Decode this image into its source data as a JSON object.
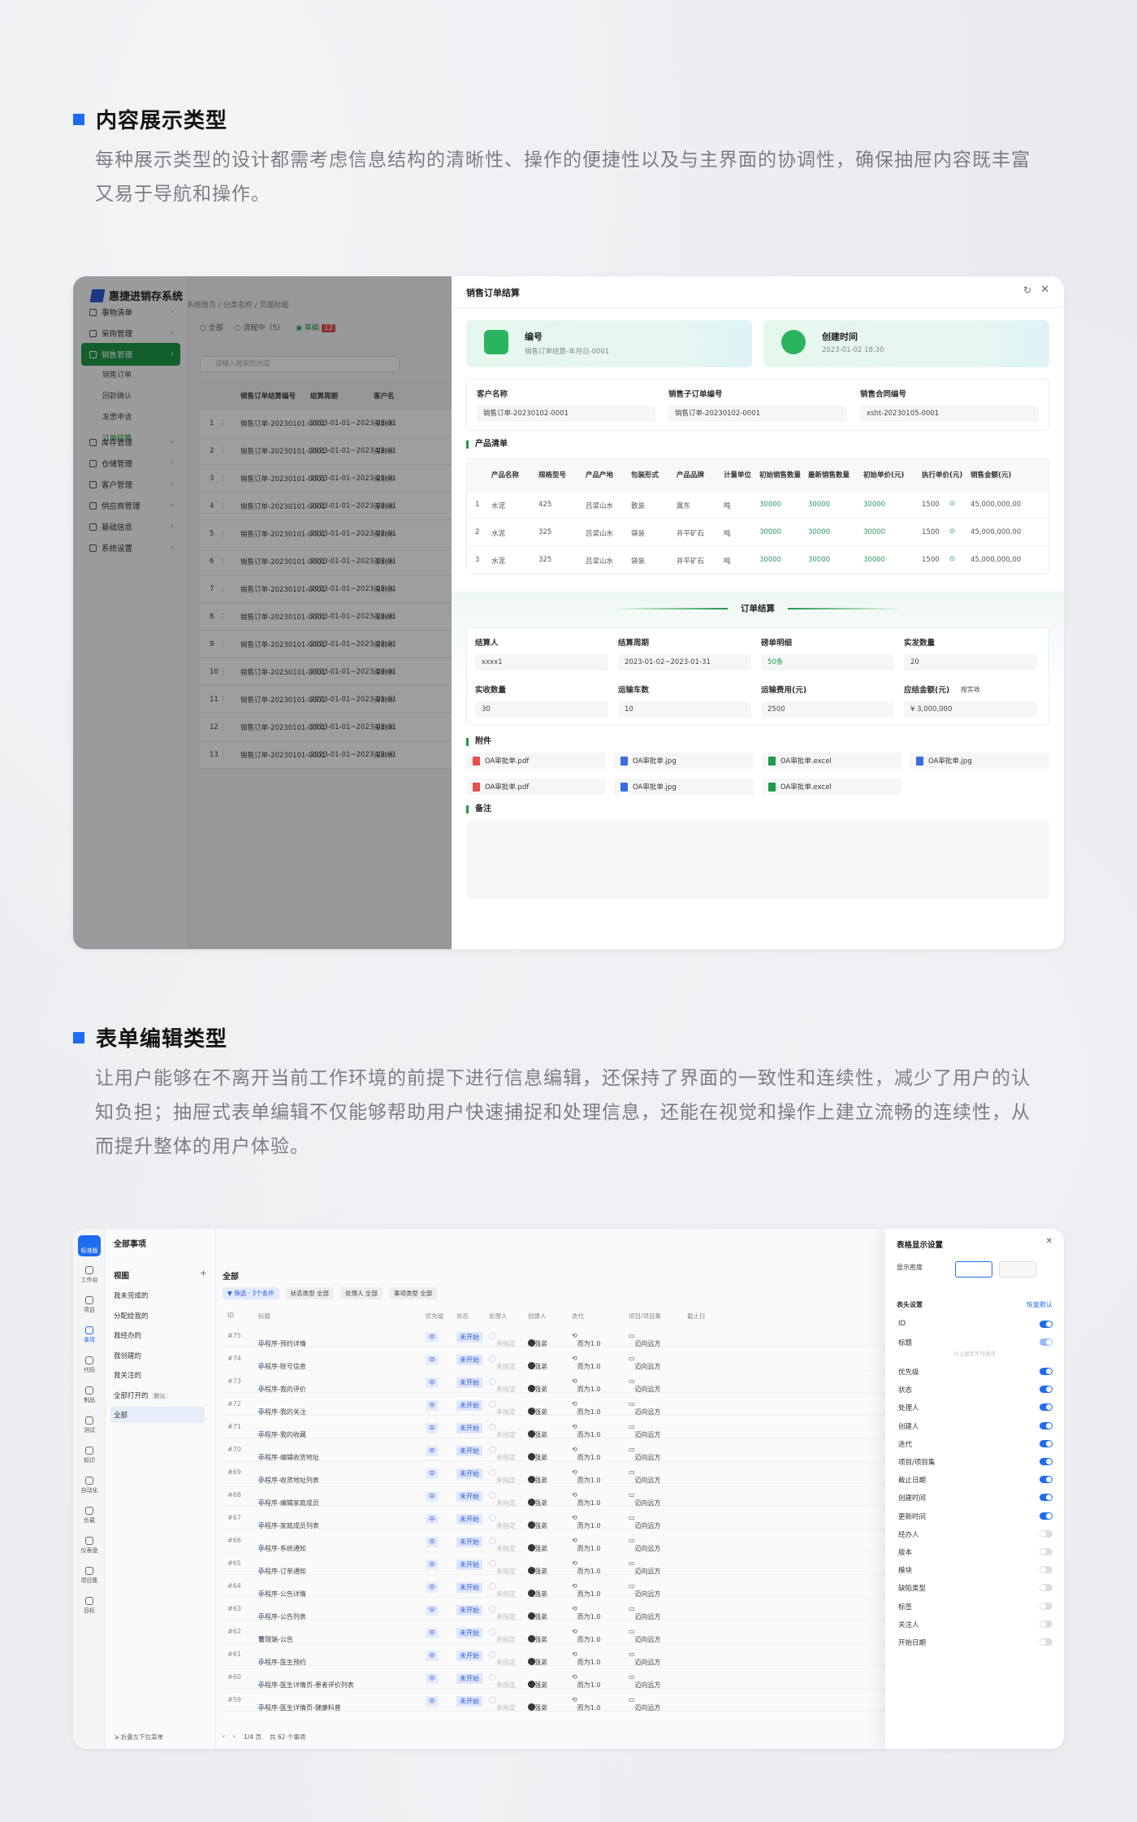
{
  "section1": {
    "title": "内容展示类型",
    "desc": "每种展示类型的设计都需考虑信息结构的清晰性、操作的便捷性以及与主界面的协调性，确保抽屉内容既丰富又易于导航和操作。"
  },
  "section2": {
    "title": "表单编辑类型",
    "desc": "让用户能够在不离开当前工作环境的前提下进行信息编辑，还保持了界面的一致性和连续性，减少了用户的认知负担；抽屉式表单编辑不仅能够帮助用户快速捕捉和处理信息，还能在视觉和操作上建立流畅的连续性，从而提升整体的用户体验。"
  },
  "app1": {
    "logo": "惠捷进销存系统",
    "breadcrumb": "系统首页  /  分类名称  /  页面标题",
    "nav": [
      {
        "label": "事物清单"
      },
      {
        "label": "采购管理"
      },
      {
        "label": "销售管理"
      },
      {
        "label": "库存管理"
      },
      {
        "label": "仓储管理"
      },
      {
        "label": "客户管理"
      },
      {
        "label": "供应商管理"
      },
      {
        "label": "基础信息"
      },
      {
        "label": "系统设置"
      }
    ],
    "subnav": [
      "销售订单",
      "回款确认",
      "发票申请",
      "订单结算"
    ],
    "filters": {
      "all": "全部",
      "process": "流程中（5）",
      "draft": "草稿",
      "draft_count": "12"
    },
    "search_placeholder": "请输入搜索的内容",
    "list_headers": [
      "销售订单结算编号",
      "结算周期",
      "客户名"
    ],
    "list_rows": [
      {
        "no": "1",
        "code": "销售订单-20230101-0001",
        "period": "2023-01-01~2023-02-01",
        "cust": "深圳木"
      },
      {
        "no": "2",
        "code": "销售订单-20230101-0001",
        "period": "2023-01-01~2023-02-01",
        "cust": "深圳木"
      },
      {
        "no": "3",
        "code": "销售订单-20230101-0001",
        "period": "2023-01-01~2023-02-01",
        "cust": "深圳木"
      },
      {
        "no": "4",
        "code": "销售订单-20230101-0001",
        "period": "2023-01-01~2023-02-01",
        "cust": "深圳木"
      },
      {
        "no": "5",
        "code": "销售订单-20230101-0001",
        "period": "2023-01-01~2023-02-01",
        "cust": "深圳木"
      },
      {
        "no": "6",
        "code": "销售订单-20230101-0001",
        "period": "2023-01-01~2023-02-01",
        "cust": "深圳木"
      },
      {
        "no": "7",
        "code": "销售订单-20230101-0001",
        "period": "2023-01-01~2023-02-01",
        "cust": "深圳木"
      },
      {
        "no": "8",
        "code": "销售订单-20230101-0001",
        "period": "2023-01-01~2023-02-01",
        "cust": "深圳木"
      },
      {
        "no": "9",
        "code": "销售订单-20230101-0001",
        "period": "2023-01-01~2023-02-01",
        "cust": "深圳木"
      },
      {
        "no": "10",
        "code": "销售订单-20230101-0001",
        "period": "2023-01-01~2023-02-01",
        "cust": "深圳木"
      },
      {
        "no": "11",
        "code": "销售订单-20230101-0001",
        "period": "2023-01-01~2023-02-01",
        "cust": "深圳木"
      },
      {
        "no": "12",
        "code": "销售订单-20230101-0001",
        "period": "2023-01-01~2023-02-01",
        "cust": "深圳木"
      },
      {
        "no": "13",
        "code": "销售订单-20230101-0001",
        "period": "2023-01-01~2023-02-01",
        "cust": "深圳木"
      }
    ]
  },
  "drawer": {
    "title": "销售订单结算",
    "card1_title": "编号",
    "card1_sub": "销售订单结算-年月日-0001",
    "card2_title": "创建时间",
    "card2_sub": "2023-01-02 18:30",
    "fields": [
      {
        "label": "客户名称",
        "value": "销售订单-20230102-0001"
      },
      {
        "label": "销售子订单编号",
        "value": "销售订单-20230102-0001"
      },
      {
        "label": "销售合同编号",
        "value": "xsht-20230105-0001"
      }
    ],
    "products_title": "产品清单",
    "product_headers": [
      "产品名称",
      "规格型号",
      "产品产地",
      "包装形式",
      "产品品牌",
      "计量单位",
      "初始销售数量",
      "最新销售数量",
      "初始单价(元)",
      "执行单价(元)",
      "销售金额(元)"
    ],
    "products": [
      {
        "no": "1",
        "cells": [
          "水泥",
          "425",
          "吕梁山水",
          "散装",
          "冀东",
          "吨",
          "30000",
          "30000",
          "30000",
          "1500",
          "45,000,000,00"
        ]
      },
      {
        "no": "2",
        "cells": [
          "水泥",
          "325",
          "吕梁山水",
          "袋装",
          "井平矿石",
          "吨",
          "30000",
          "30000",
          "30000",
          "1500",
          "45,000,000,00"
        ]
      },
      {
        "no": "3",
        "cells": [
          "水泥",
          "325",
          "吕梁山水",
          "袋装",
          "井平矿石",
          "吨",
          "30000",
          "30000",
          "30000",
          "1500",
          "45,000,000,00"
        ]
      }
    ],
    "settle_title": "订单结算",
    "settle": [
      {
        "label": "结算人",
        "value": "xxxx1"
      },
      {
        "label": "结算周期",
        "value": "2023-01-02~2023-01-31"
      },
      {
        "label": "磅单明细",
        "value": "50条"
      },
      {
        "label": "实发数量",
        "value": "20"
      },
      {
        "label": "实收数量",
        "value": "30"
      },
      {
        "label": "运输车数",
        "value": "10"
      },
      {
        "label": "运输费用(元)",
        "value": "2500"
      },
      {
        "label": "应结金额(元)",
        "value": "¥ 3,000,000"
      }
    ],
    "settle_link": "按实收",
    "attach_title": "附件",
    "files": [
      {
        "name": "OA审批单.pdf",
        "color": "#e54d4d"
      },
      {
        "name": "OA审批单.jpg",
        "color": "#3a6be0"
      },
      {
        "name": "OA审批单.excel",
        "color": "#1f9a47"
      },
      {
        "name": "OA审批单.jpg",
        "color": "#3a6be0"
      },
      {
        "name": "OA审批单.pdf",
        "color": "#e54d4d"
      },
      {
        "name": "OA审批单.jpg",
        "color": "#3a6be0"
      },
      {
        "name": "OA审批单.excel",
        "color": "#1f9a47"
      }
    ],
    "remark_title": "备注"
  },
  "app2": {
    "title": "全部事项",
    "rail": [
      "标准版",
      "工作台",
      "项目",
      "事项",
      "代码",
      "制品",
      "测试",
      "知识",
      "自动化",
      "负载",
      "仪表盘",
      "项目集",
      "目标"
    ],
    "views_title": "视图",
    "views": [
      "我未完成的",
      "分配给我的",
      "我经办的",
      "我创建的",
      "我关注的",
      "全部打开的",
      "全部"
    ],
    "views_default_badge": "默认",
    "bottom": "折叠左下拉菜单",
    "crumb": "全部",
    "filter_chip": "筛选 · 3个条件",
    "filter_state": "状态类型 全部",
    "filter_assignee": "处理人 全部",
    "filter_type": "事项类型 全部",
    "col_headers": [
      "ID",
      "标题",
      "优先级",
      "状态",
      "处理人",
      "创建人",
      "迭代",
      "项目/项目集",
      "截止日"
    ],
    "rows": [
      {
        "id": "#75",
        "title": "小程序-预约详情"
      },
      {
        "id": "#74",
        "title": "小程序-账号信息"
      },
      {
        "id": "#73",
        "title": "小程序-我的评价"
      },
      {
        "id": "#72",
        "title": "小程序-我的关注"
      },
      {
        "id": "#71",
        "title": "小程序-我的收藏"
      },
      {
        "id": "#70",
        "title": "小程序-编辑收货地址"
      },
      {
        "id": "#69",
        "title": "小程序-收货地址列表"
      },
      {
        "id": "#68",
        "title": "小程序-编辑家庭成员"
      },
      {
        "id": "#67",
        "title": "小程序-家庭成员列表"
      },
      {
        "id": "#66",
        "title": "小程序-系统通知"
      },
      {
        "id": "#65",
        "title": "小程序-订单通知"
      },
      {
        "id": "#64",
        "title": "小程序-公告详情"
      },
      {
        "id": "#63",
        "title": "小程序-公告列表"
      },
      {
        "id": "#62",
        "title": "管理端-公告"
      },
      {
        "id": "#61",
        "title": "小程序-医生预约"
      },
      {
        "id": "#60",
        "title": "小程序-医生详情页-患者评价列表"
      },
      {
        "id": "#59",
        "title": "小程序-医生详情页-健康科普"
      }
    ],
    "row_priority": "中",
    "row_status": "未开始",
    "row_assignee": "未指定",
    "row_creator": "马强弟",
    "row_iter": "而为1.0",
    "row_project": "迈向远方",
    "pager": "1/4 页",
    "total": "共 62 个事项",
    "panel": {
      "title": "表格显示设置",
      "density": "显示密度",
      "header_settings": "表头设置",
      "reset": "恢复默认",
      "divider": "以上固定不可排序",
      "items": [
        {
          "label": "ID",
          "on": true
        },
        {
          "label": "标题",
          "on": true
        },
        {
          "label": "优先级",
          "on": true
        },
        {
          "label": "状态",
          "on": true
        },
        {
          "label": "处理人",
          "on": true
        },
        {
          "label": "创建人",
          "on": true
        },
        {
          "label": "迭代",
          "on": true
        },
        {
          "label": "项目/项目集",
          "on": true
        },
        {
          "label": "截止日期",
          "on": true
        },
        {
          "label": "创建时间",
          "on": true
        },
        {
          "label": "更新时间",
          "on": true
        },
        {
          "label": "经办人",
          "on": false
        },
        {
          "label": "版本",
          "on": false
        },
        {
          "label": "模块",
          "on": false
        },
        {
          "label": "缺陷类型",
          "on": false
        },
        {
          "label": "标签",
          "on": false
        },
        {
          "label": "关注人",
          "on": false
        },
        {
          "label": "开始日期",
          "on": false
        }
      ]
    }
  }
}
